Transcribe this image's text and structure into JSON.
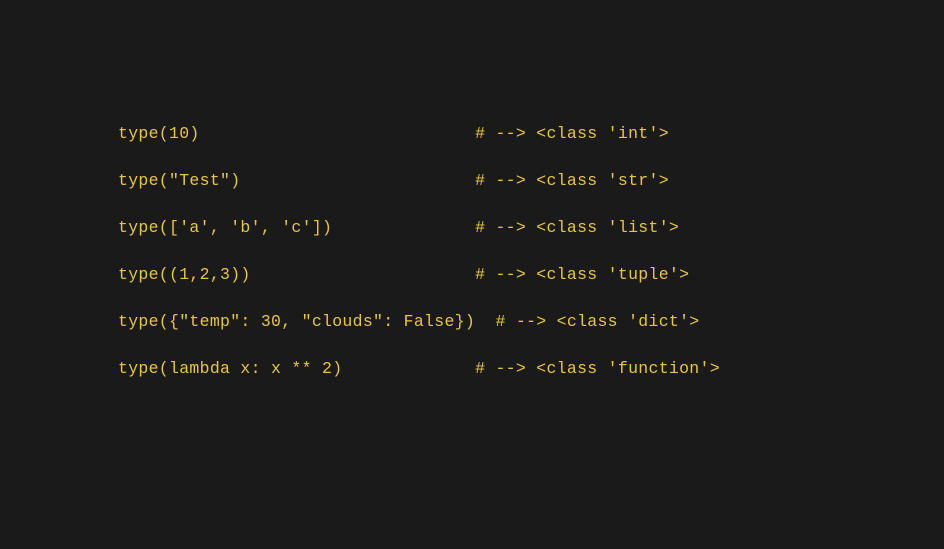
{
  "code_lines": [
    {
      "code": "type(10)                           ",
      "comment": "# --> <class 'int'>"
    },
    {
      "code": "type(\"Test\")                       ",
      "comment": "# --> <class 'str'>"
    },
    {
      "code": "type(['a', 'b', 'c'])              ",
      "comment": "# --> <class 'list'>"
    },
    {
      "code": "type((1,2,3))                      ",
      "comment": "# --> <class 'tuple'>"
    },
    {
      "code": "type({\"temp\": 30, \"clouds\": False})  ",
      "comment": "# --> <class 'dict'>"
    },
    {
      "code": "type(lambda x: x ** 2)             ",
      "comment": "# --> <class 'function'>"
    }
  ]
}
